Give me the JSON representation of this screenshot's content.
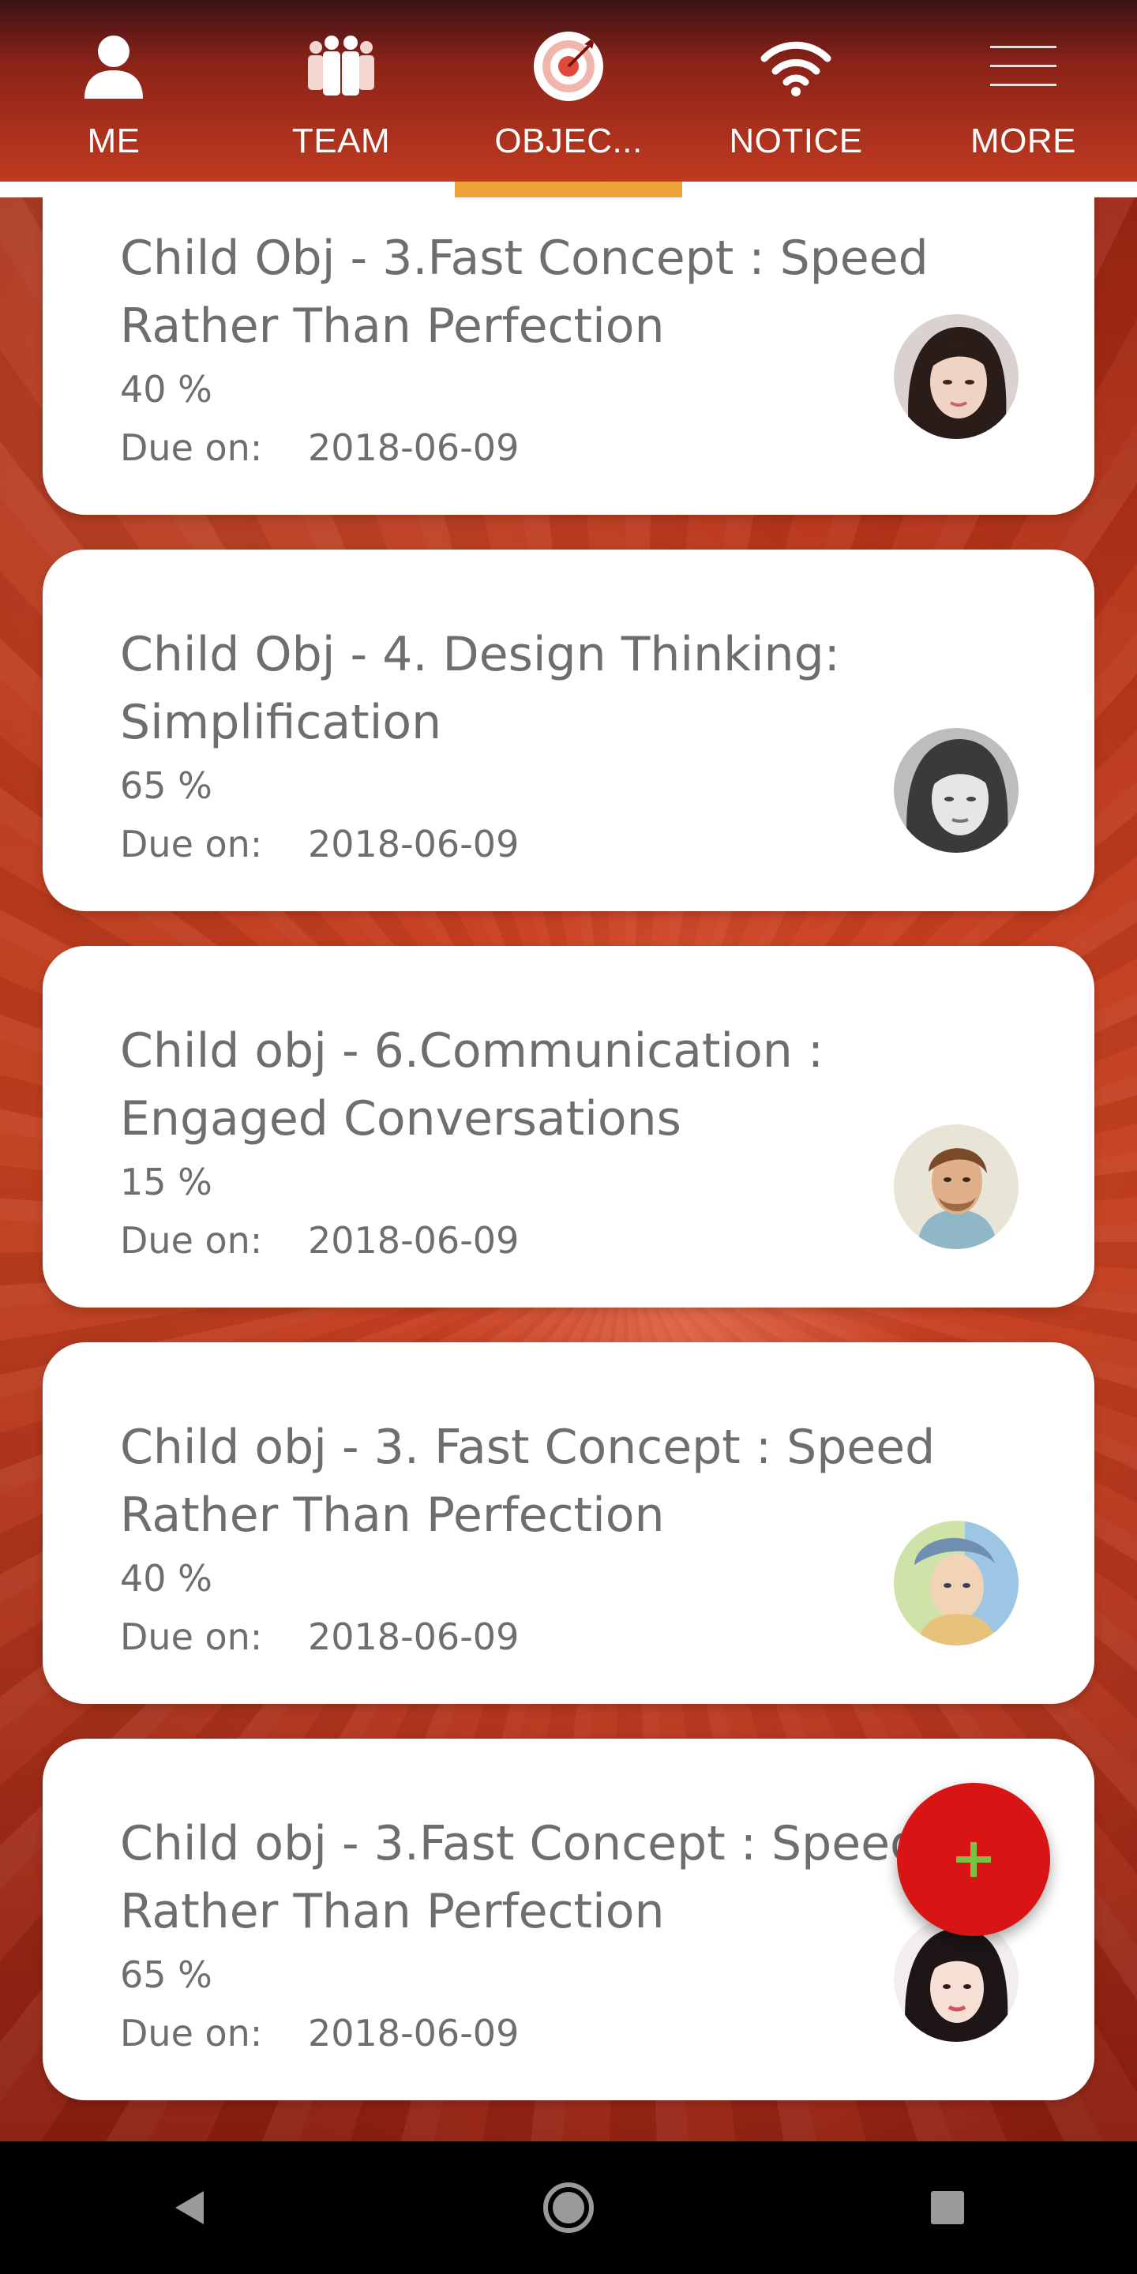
{
  "colors": {
    "header_top": "#3c1214",
    "header_bottom": "#c03a20",
    "active_indicator": "#f0a33a",
    "card_bg": "#ffffff",
    "card_text": "#6e6e6e",
    "fab_bg": "#d81414",
    "fab_plus": "#7ac142"
  },
  "nav": {
    "active_index": 2,
    "items": [
      {
        "label": "ME",
        "icon": "person-icon"
      },
      {
        "label": "TEAM",
        "icon": "team-icon"
      },
      {
        "label": "OBJEC...",
        "icon": "target-icon"
      },
      {
        "label": "NOTICE",
        "icon": "wifi-icon"
      },
      {
        "label": "MORE",
        "icon": "menu-icon"
      }
    ]
  },
  "objectives": [
    {
      "title": "Child Obj - 3.Fast Concept : Speed Rather Than Perfection",
      "percent": "40  %",
      "due_label": "Due on:",
      "due_date": "2018-06-09",
      "avatar": "avatar-woman-dark-hair"
    },
    {
      "title": "Child Obj - 4. Design Thinking: Simplification",
      "percent": "65  %",
      "due_label": "Due on:",
      "due_date": "2018-06-09",
      "avatar": "avatar-woman-grayscale"
    },
    {
      "title": "Child obj - 6.Communication : Engaged Conversations",
      "percent": "15  %",
      "due_label": "Due on:",
      "due_date": "2018-06-09",
      "avatar": "avatar-man-watercolor"
    },
    {
      "title": "Child obj - 3. Fast Concept : Speed Rather Than Perfection",
      "percent": "40  %",
      "due_label": "Due on:",
      "due_date": "2018-06-09",
      "avatar": "avatar-young-man-watercolor"
    },
    {
      "title": "Child obj - 3.Fast Concept : Speed Rather Than Perfection",
      "percent": "65  %",
      "due_label": "Due on:",
      "due_date": "2018-06-09",
      "avatar": "avatar-woman-portrait"
    }
  ],
  "fab": {
    "icon": "plus-icon"
  },
  "system_nav": {
    "back": "back-icon",
    "home": "home-icon",
    "recents": "recents-icon"
  }
}
